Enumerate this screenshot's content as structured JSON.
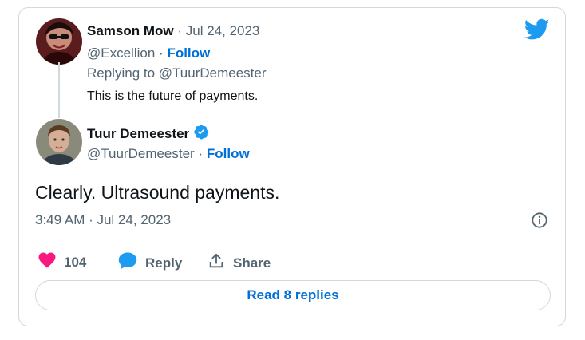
{
  "parent_tweet": {
    "author_name": "Samson Mow",
    "date": "· Jul 24, 2023",
    "handle": "@Excellion",
    "separator": "·",
    "follow_label": "Follow",
    "replying_prefix": "Replying to",
    "replying_to": "@TuurDemeester",
    "text": "This is the future of payments."
  },
  "main_tweet": {
    "author_name": "Tuur Demeester",
    "verified": true,
    "handle": "@TuurDemeester",
    "separator": "·",
    "follow_label": "Follow",
    "text": "Clearly. Ultrasound payments.",
    "timestamp": "3:49 AM · Jul 24, 2023"
  },
  "actions": {
    "likes_count": "104",
    "reply_label": "Reply",
    "share_label": "Share"
  },
  "read_replies_label": "Read 8 replies",
  "colors": {
    "accent": "#006fd6",
    "twitter_blue": "#1d9bf0",
    "like_pink": "#f91880",
    "muted": "#536471",
    "border": "#cfd9de"
  },
  "icons": [
    "twitter-logo-icon",
    "verified-badge-icon",
    "info-icon",
    "heart-icon",
    "reply-bubble-icon",
    "share-icon"
  ]
}
